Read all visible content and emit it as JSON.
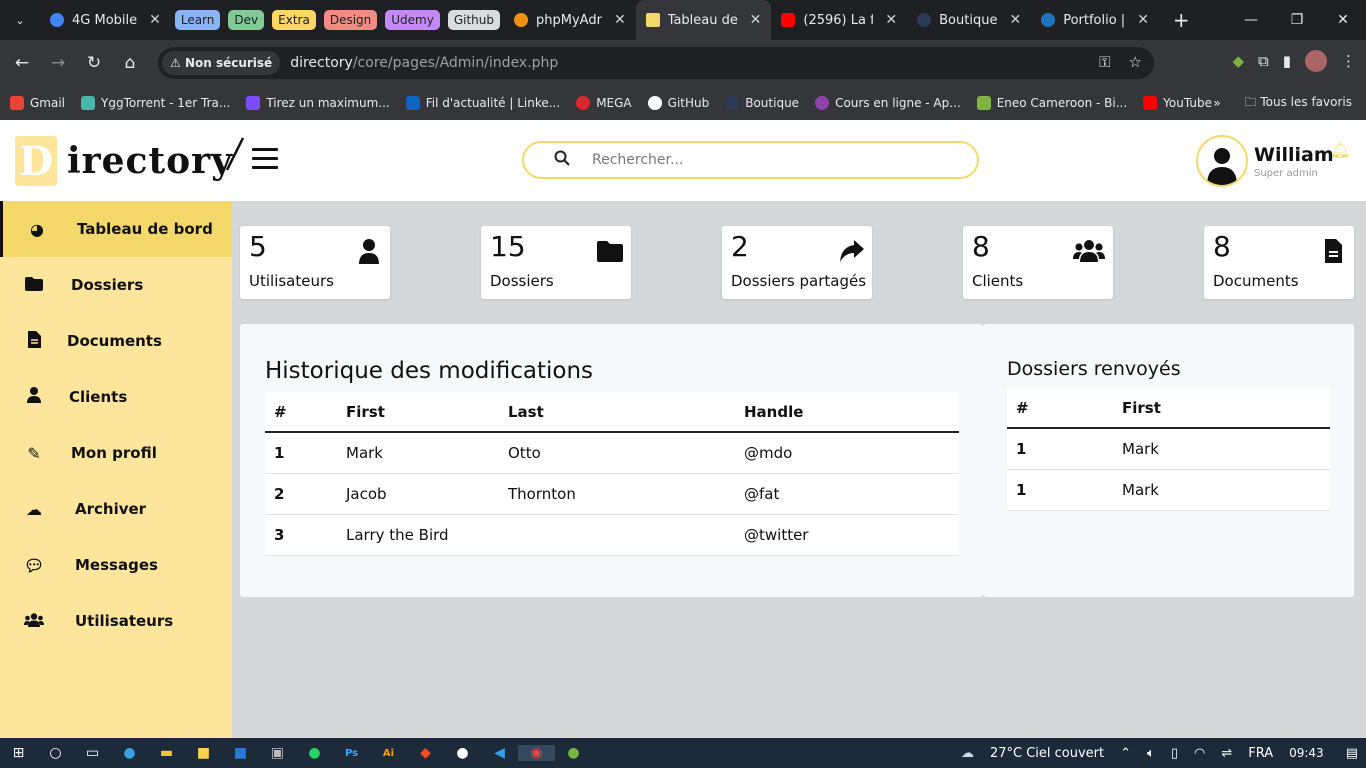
{
  "browser": {
    "tabs": [
      {
        "title": "4G Mobile",
        "favicon_color": "#4285f4"
      },
      {
        "title": "phpMyAdr",
        "favicon_color": "#f29111"
      },
      {
        "title": "Tableau de",
        "favicon_color": "#f5d86a",
        "active": true
      },
      {
        "title": "(2596) La f",
        "favicon_color": "#ff0000"
      },
      {
        "title": "Boutique",
        "favicon_color": "#2b3a55"
      },
      {
        "title": "Portfolio |",
        "favicon_color": "#1e73be"
      }
    ],
    "tab_groups": [
      {
        "label": "Learn",
        "color": "#8ab4f8"
      },
      {
        "label": "Dev",
        "color": "#81c995"
      },
      {
        "label": "Extra",
        "color": "#fdd663"
      },
      {
        "label": "Design",
        "color": "#f28b82"
      },
      {
        "label": "Udemy",
        "color": "#c58af9"
      },
      {
        "label": "Github",
        "color": "#dadce0"
      }
    ],
    "security_label": "Non sécurisé",
    "url_host": "directory",
    "url_path": "/core/pages/Admin/index.php",
    "bookmarks": [
      {
        "label": "Gmail",
        "color": "#ea4335"
      },
      {
        "label": "YggTorrent - 1er Tra...",
        "color": "#4db6ac"
      },
      {
        "label": "Tirez un maximum...",
        "color": "#7c4dff"
      },
      {
        "label": "Fil d'actualité | Linke...",
        "color": "#0a66c2"
      },
      {
        "label": "MEGA",
        "color": "#d9272e"
      },
      {
        "label": "GitHub",
        "color": "#ffffff"
      },
      {
        "label": "Boutique",
        "color": "#2b3a55"
      },
      {
        "label": "Cours en ligne - Ap...",
        "color": "#8e44ad"
      },
      {
        "label": "Eneo Cameroon - Bi...",
        "color": "#7cb342"
      },
      {
        "label": "YouTube",
        "color": "#ff0000"
      }
    ],
    "all_bookmarks": "Tous les favoris"
  },
  "app": {
    "logo_letter": "D",
    "logo_word": "irectory",
    "search_placeholder": "Rechercher...",
    "user_name": "William",
    "user_role": "Super admin",
    "accent": "#f5d86a",
    "sidebar_bg": "#fde59c"
  },
  "sidebar": {
    "items": [
      {
        "label": "Tableau de bord",
        "icon": "dashboard-icon",
        "active": true
      },
      {
        "label": "Dossiers",
        "icon": "folder-icon"
      },
      {
        "label": "Documents",
        "icon": "document-icon"
      },
      {
        "label": "Clients",
        "icon": "user-icon"
      },
      {
        "label": "Mon profil",
        "icon": "edit-icon"
      },
      {
        "label": "Archiver",
        "icon": "cloud-upload-icon"
      },
      {
        "label": "Messages",
        "icon": "comments-icon"
      },
      {
        "label": "Utilisateurs",
        "icon": "users-icon"
      }
    ]
  },
  "stats": [
    {
      "value": "5",
      "label": "Utilisateurs",
      "icon": "user-icon"
    },
    {
      "value": "15",
      "label": "Dossiers",
      "icon": "folder-icon"
    },
    {
      "value": "2",
      "label": "Dossiers partagés",
      "icon": "share-icon"
    },
    {
      "value": "8",
      "label": "Clients",
      "icon": "users-icon"
    },
    {
      "value": "8",
      "label": "Documents",
      "icon": "document-icon"
    }
  ],
  "history": {
    "title": "Historique des modifications",
    "headers": [
      "#",
      "First",
      "Last",
      "Handle"
    ],
    "rows": [
      [
        "1",
        "Mark",
        "Otto",
        "@mdo"
      ],
      [
        "2",
        "Jacob",
        "Thornton",
        "@fat"
      ],
      [
        "3",
        "Larry the Bird",
        "",
        "@twitter"
      ]
    ]
  },
  "returned": {
    "title": "Dossiers renvoyés",
    "headers": [
      "#",
      "First"
    ],
    "rows": [
      [
        "1",
        "Mark"
      ],
      [
        "1",
        "Mark"
      ]
    ]
  },
  "taskbar": {
    "weather": "27°C  Ciel couvert",
    "lang": "FRA",
    "time": "09:43"
  }
}
